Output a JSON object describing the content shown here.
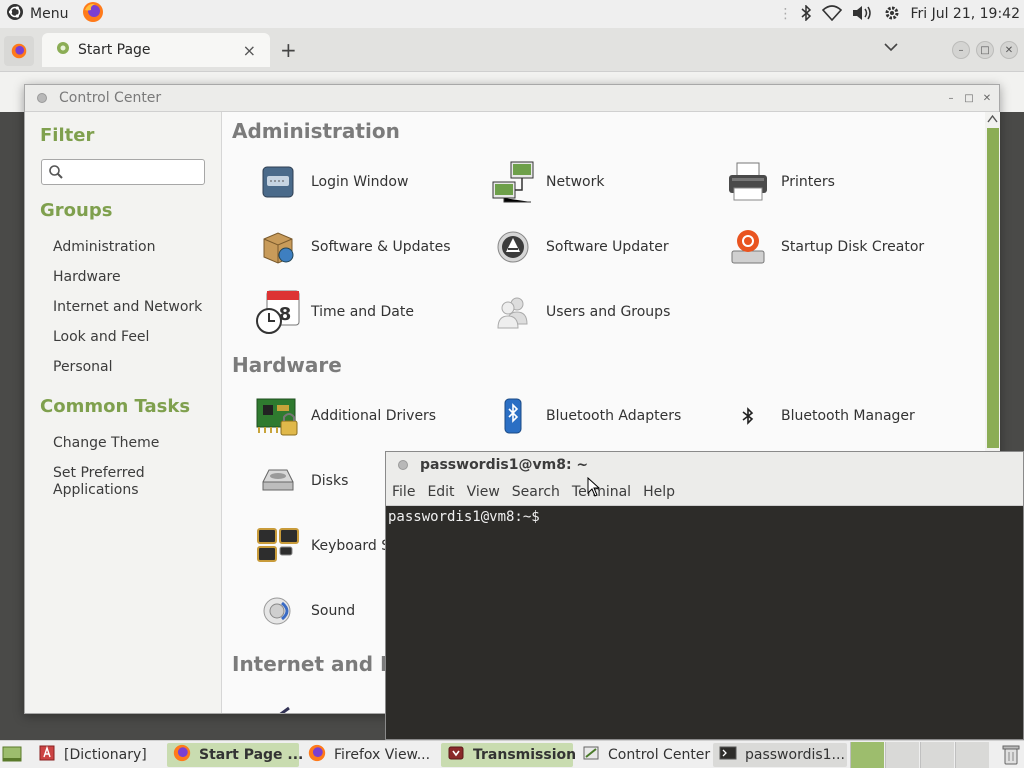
{
  "top_panel": {
    "menu_label": "Menu",
    "clock": "Fri Jul 21, 19:42",
    "icons": [
      "ubuntu-logo-icon",
      "firefox-icon",
      "bluetooth-icon",
      "wifi-icon",
      "volume-icon",
      "settings-icon"
    ]
  },
  "firefox": {
    "tab_title": "Start Page",
    "new_tab": "+",
    "close_tab": "×",
    "tab_list": "⌄"
  },
  "control_center": {
    "title": "Control Center",
    "sidebar": {
      "filter_heading": "Filter",
      "search_value": "",
      "groups_heading": "Groups",
      "groups": [
        "Administration",
        "Hardware",
        "Internet and Network",
        "Look and Feel",
        "Personal"
      ],
      "tasks_heading": "Common Tasks",
      "tasks": [
        "Change Theme",
        "Set Preferred Applications"
      ]
    },
    "sections": {
      "administration": {
        "heading": "Administration",
        "items": [
          "Login Window",
          "Network",
          "Printers",
          "Software & Updates",
          "Software Updater",
          "Startup Disk Creator",
          "Time and Date",
          "Users and Groups"
        ]
      },
      "hardware": {
        "heading": "Hardware",
        "items": [
          "Additional Drivers",
          "Bluetooth Adapters",
          "Bluetooth Manager",
          "Disks",
          "Keyboard S",
          "Sound"
        ]
      },
      "internet": {
        "heading": "Internet and Ne"
      }
    }
  },
  "terminal": {
    "title": "passwordis1@vm8: ~",
    "menus": [
      "File",
      "Edit",
      "View",
      "Search",
      "Terminal",
      "Help"
    ],
    "prompt": "passwordis1@vm8:~$"
  },
  "taskbar": {
    "items": [
      "[Dictionary]",
      "Start Page ...",
      "Firefox View...",
      "Transmission",
      "Control Center",
      "passwordis1..."
    ]
  },
  "colors": {
    "accent_green": "#7fa04e",
    "terminal_bg": "#2d2c29",
    "panel_bg": "#efefef"
  }
}
